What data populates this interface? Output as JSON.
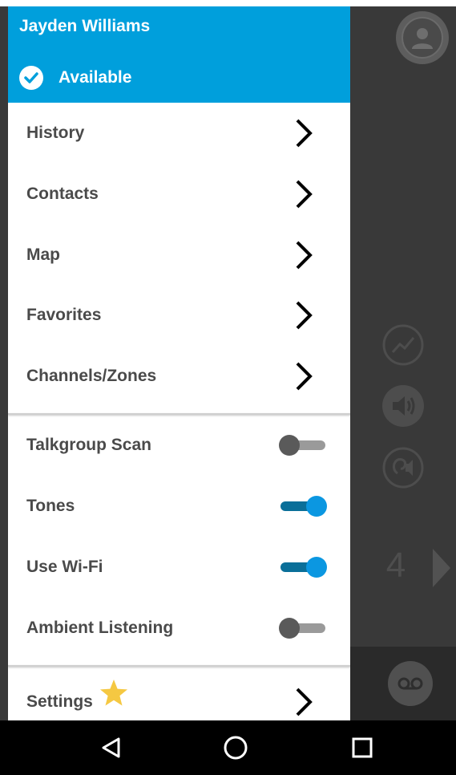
{
  "user": {
    "name": "Jayden Williams",
    "status": "Available"
  },
  "menu": {
    "nav_items": [
      {
        "label": "History"
      },
      {
        "label": "Contacts"
      },
      {
        "label": "Map"
      },
      {
        "label": "Favorites"
      },
      {
        "label": "Channels/Zones"
      }
    ],
    "toggles": [
      {
        "label": "Talkgroup Scan",
        "on": false
      },
      {
        "label": "Tones",
        "on": true
      },
      {
        "label": "Use Wi-Fi",
        "on": true
      },
      {
        "label": "Ambient Listening",
        "on": false
      }
    ],
    "settings_label": "Settings"
  },
  "background": {
    "channel_number": "4"
  },
  "colors": {
    "accent": "#009fdc",
    "toggle_on": "#0b97e1",
    "star": "#f5c842"
  },
  "icons": [
    "check-icon",
    "chevron-right-icon",
    "star-icon",
    "avatar-icon",
    "signal-icon",
    "speaker-icon",
    "ear-speaker-icon",
    "voicemail-icon",
    "back-icon",
    "home-icon",
    "recents-icon"
  ]
}
